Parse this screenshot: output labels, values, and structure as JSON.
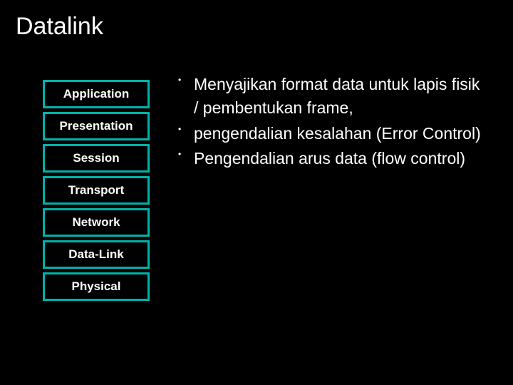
{
  "title": "Datalink",
  "layers": [
    "Application",
    "Presentation",
    "Session",
    "Transport",
    "Network",
    "Data-Link",
    "Physical"
  ],
  "bullets": [
    "Menyajikan format data untuk lapis fisik / pembentukan frame,",
    "pengendalian kesalahan (Error Control)",
    "Pengendalian arus data (flow control)"
  ]
}
